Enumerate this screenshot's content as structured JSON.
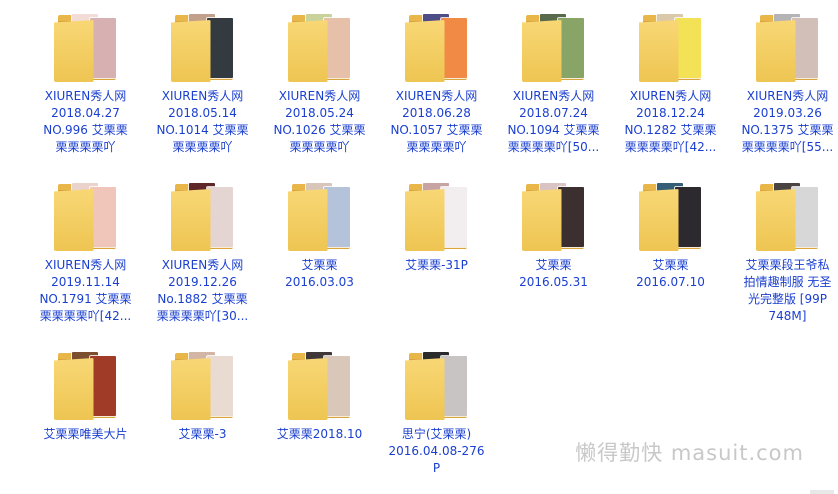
{
  "folders": [
    {
      "label": "XIUREN秀人网\n2018.04.27\nNO.996 艾栗栗\n栗栗栗栗吖",
      "c1": "#f3dcd7",
      "c2": "#d7b1b1"
    },
    {
      "label": "XIUREN秀人网\n2018.05.14\nNO.1014 艾栗栗\n栗栗栗栗吖",
      "c1": "#c2a08b",
      "c2": "#333b40"
    },
    {
      "label": "XIUREN秀人网\n2018.05.24\nNO.1026 艾栗栗\n栗栗栗栗吖",
      "c1": "#c7d39a",
      "c2": "#e6c0a8"
    },
    {
      "label": "XIUREN秀人网\n2018.06.28\nNO.1057 艾栗栗\n栗栗栗栗吖",
      "c1": "#4e4d86",
      "c2": "#f08a44"
    },
    {
      "label": "XIUREN秀人网\n2018.07.24\nNO.1094 艾栗栗\n栗栗栗栗吖[50...",
      "c1": "#596a4c",
      "c2": "#88a467"
    },
    {
      "label": "XIUREN秀人网\n2018.12.24\nNO.1282 艾栗栗\n栗栗栗栗吖[42...",
      "c1": "#d9c8a9",
      "c2": "#f3e255"
    },
    {
      "label": "XIUREN秀人网\n2019.03.26\nNO.1375 艾栗栗\n栗栗栗栗吖[55...",
      "c1": "#b4b3b6",
      "c2": "#d2c0b8"
    },
    {
      "label": "XIUREN秀人网\n2019.11.14\nNO.1791 艾栗栗\n栗栗栗栗吖[42...",
      "c1": "#ead3cc",
      "c2": "#f0c6ba"
    },
    {
      "label": "XIUREN秀人网\n2019.12.26\nNo.1882 艾栗栗\n栗栗栗栗吖[30...",
      "c1": "#5f2727",
      "c2": "#e5d5d2"
    },
    {
      "label": "艾栗栗\n2016.03.03",
      "c1": "#d7c6b9",
      "c2": "#b4c3da"
    },
    {
      "label": "艾栗栗-31P",
      "c1": "#c7a3a3",
      "c2": "#f2eef0"
    },
    {
      "label": "艾栗栗\n2016.05.31",
      "c1": "#d9c3c3",
      "c2": "#3b2f30"
    },
    {
      "label": "艾栗栗\n2016.07.10",
      "c1": "#355f76",
      "c2": "#2d2a2f"
    },
    {
      "label": "艾栗栗段王爷私\n拍情趣制服 无圣\n光完整版 [99P\n748M]",
      "c1": "#4a4342",
      "c2": "#d7d7d8"
    },
    {
      "label": "艾栗栗唯美大片",
      "c1": "#7b4f2f",
      "c2": "#9f3b26"
    },
    {
      "label": "艾栗栗-3",
      "c1": "#d2b5a5",
      "c2": "#eadbd2"
    },
    {
      "label": "艾栗栗2018.10",
      "c1": "#3f3738",
      "c2": "#d9c7ba"
    },
    {
      "label": "思宁(艾栗栗)\n2016.04.08-276\nP",
      "c1": "#2b2b2b",
      "c2": "#c8c4c4"
    }
  ],
  "watermark": "懒得勤快 masuit.com"
}
